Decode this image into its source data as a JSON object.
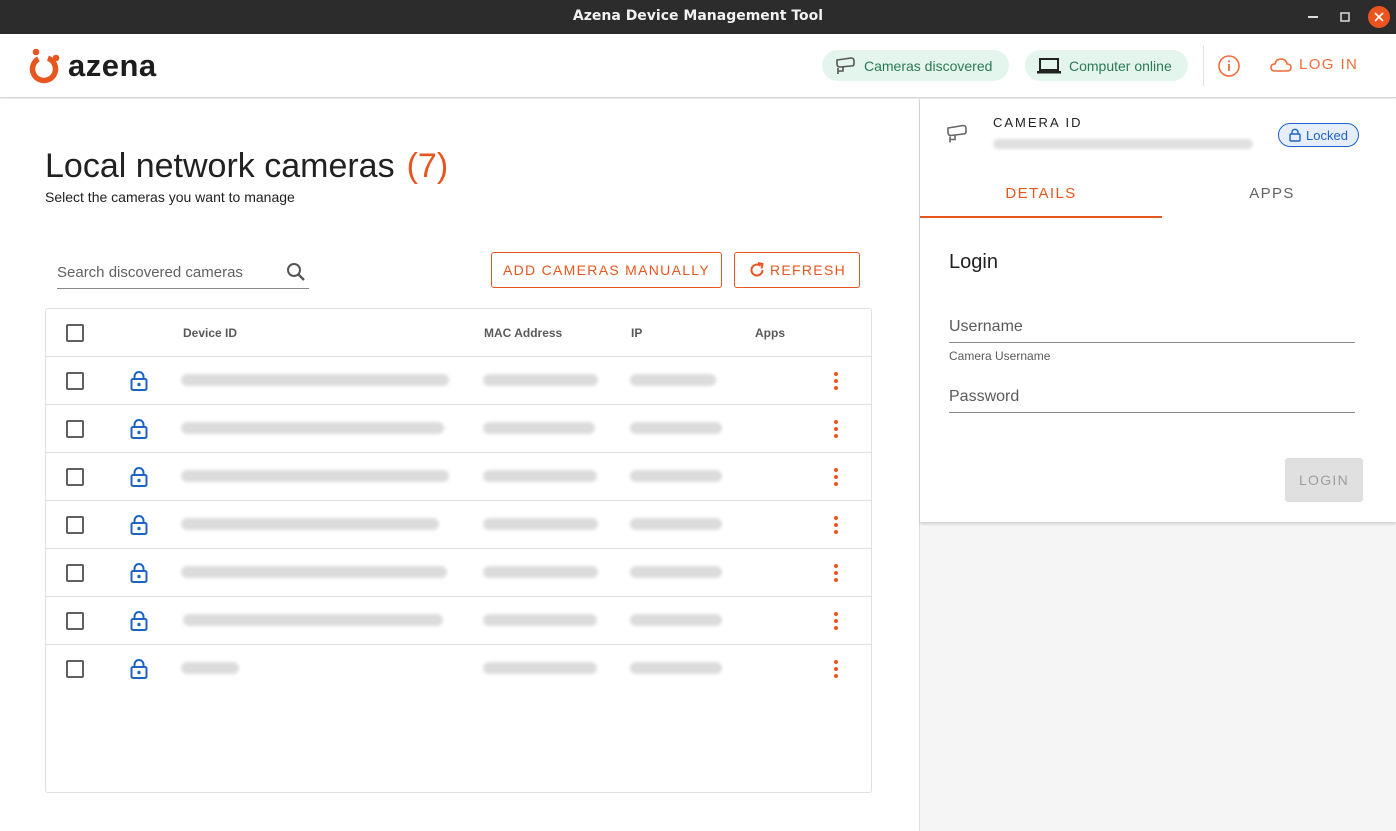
{
  "window": {
    "title": "Azena Device Management Tool"
  },
  "header": {
    "logo_text": "azena",
    "chip_cameras": "Cameras discovered",
    "chip_computer": "Computer online",
    "login_label": "LOG IN"
  },
  "main": {
    "title": "Local network cameras",
    "count": "(7)",
    "subtitle": "Select the cameras you want to manage",
    "search_placeholder": "Search discovered cameras",
    "add_button": "ADD CAMERAS MANUALLY",
    "refresh_button": "REFRESH",
    "columns": [
      "Device ID",
      "MAC Address",
      "IP",
      "Apps"
    ],
    "row_count": 7
  },
  "panel": {
    "camera_id_label": "CAMERA ID",
    "status_badge": "Locked",
    "tabs": [
      "DETAILS",
      "APPS"
    ],
    "login_heading": "Login",
    "username_placeholder": "Username",
    "username_hint": "Camera Username",
    "password_placeholder": "Password",
    "login_button": "LOGIN"
  },
  "colors": {
    "accent": "#e8561f",
    "lock_blue": "#1e63c7",
    "chip_green": "#2b7a55"
  }
}
